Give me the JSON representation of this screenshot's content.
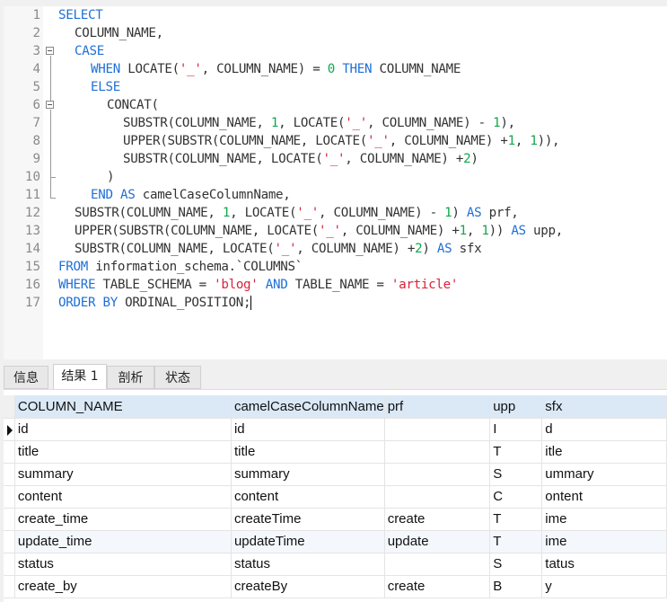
{
  "editor": {
    "lines": [
      {
        "n": "1",
        "indent": 0,
        "tokens": [
          [
            "kw",
            "SELECT"
          ]
        ]
      },
      {
        "n": "2",
        "indent": 1,
        "tokens": [
          [
            "",
            "COLUMN_NAME,"
          ]
        ]
      },
      {
        "n": "3",
        "indent": 1,
        "tokens": [
          [
            "kw",
            "CASE"
          ]
        ]
      },
      {
        "n": "4",
        "indent": 2,
        "tokens": [
          [
            "kw",
            "WHEN"
          ],
          [
            "",
            " LOCATE("
          ],
          [
            "str",
            "'_'"
          ],
          [
            "",
            ", COLUMN_NAME) = "
          ],
          [
            "num",
            "0"
          ],
          [
            "",
            " "
          ],
          [
            "kw",
            "THEN"
          ],
          [
            "",
            " COLUMN_NAME"
          ]
        ]
      },
      {
        "n": "5",
        "indent": 2,
        "tokens": [
          [
            "kw",
            "ELSE"
          ]
        ]
      },
      {
        "n": "6",
        "indent": 3,
        "tokens": [
          [
            "",
            "CONCAT("
          ]
        ]
      },
      {
        "n": "7",
        "indent": 4,
        "tokens": [
          [
            "",
            "SUBSTR(COLUMN_NAME, "
          ],
          [
            "num",
            "1"
          ],
          [
            "",
            ", LOCATE("
          ],
          [
            "str",
            "'_'"
          ],
          [
            "",
            ", COLUMN_NAME) - "
          ],
          [
            "num",
            "1"
          ],
          [
            "",
            "),"
          ]
        ]
      },
      {
        "n": "8",
        "indent": 4,
        "tokens": [
          [
            "",
            "UPPER(SUBSTR(COLUMN_NAME, LOCATE("
          ],
          [
            "str",
            "'_'"
          ],
          [
            "",
            ", COLUMN_NAME) +"
          ],
          [
            "num",
            "1"
          ],
          [
            "",
            ", "
          ],
          [
            "num",
            "1"
          ],
          [
            "",
            ")),"
          ]
        ]
      },
      {
        "n": "9",
        "indent": 4,
        "tokens": [
          [
            "",
            "SUBSTR(COLUMN_NAME, LOCATE("
          ],
          [
            "str",
            "'_'"
          ],
          [
            "",
            ", COLUMN_NAME) +"
          ],
          [
            "num",
            "2"
          ],
          [
            "",
            ")"
          ]
        ]
      },
      {
        "n": "10",
        "indent": 3,
        "tokens": [
          [
            "",
            ")"
          ]
        ]
      },
      {
        "n": "11",
        "indent": 2,
        "tokens": [
          [
            "kw",
            "END"
          ],
          [
            "",
            " "
          ],
          [
            "kw",
            "AS"
          ],
          [
            "",
            " camelCaseColumnName,"
          ]
        ]
      },
      {
        "n": "12",
        "indent": 1,
        "tokens": [
          [
            "",
            "SUBSTR(COLUMN_NAME, "
          ],
          [
            "num",
            "1"
          ],
          [
            "",
            ", LOCATE("
          ],
          [
            "str",
            "'_'"
          ],
          [
            "",
            ", COLUMN_NAME) - "
          ],
          [
            "num",
            "1"
          ],
          [
            "",
            ") "
          ],
          [
            "kw",
            "AS"
          ],
          [
            "",
            " prf,"
          ]
        ]
      },
      {
        "n": "13",
        "indent": 1,
        "tokens": [
          [
            "",
            "UPPER(SUBSTR(COLUMN_NAME, LOCATE("
          ],
          [
            "str",
            "'_'"
          ],
          [
            "",
            ", COLUMN_NAME) +"
          ],
          [
            "num",
            "1"
          ],
          [
            "",
            ", "
          ],
          [
            "num",
            "1"
          ],
          [
            "",
            "))"
          ],
          [
            "",
            " "
          ],
          [
            "kw",
            "AS"
          ],
          [
            "",
            " upp,"
          ]
        ]
      },
      {
        "n": "14",
        "indent": 1,
        "tokens": [
          [
            "",
            "SUBSTR(COLUMN_NAME, LOCATE("
          ],
          [
            "str",
            "'_'"
          ],
          [
            "",
            ", COLUMN_NAME) +"
          ],
          [
            "num",
            "2"
          ],
          [
            "",
            ") "
          ],
          [
            "kw",
            "AS"
          ],
          [
            "",
            " sfx"
          ]
        ]
      },
      {
        "n": "15",
        "indent": 0,
        "tokens": [
          [
            "kw",
            "FROM"
          ],
          [
            "",
            " information_schema.`COLUMNS`"
          ]
        ]
      },
      {
        "n": "16",
        "indent": 0,
        "tokens": [
          [
            "kw",
            "WHERE"
          ],
          [
            "",
            " TABLE_SCHEMA = "
          ],
          [
            "str",
            "'blog'"
          ],
          [
            "",
            " "
          ],
          [
            "kw",
            "AND"
          ],
          [
            "",
            " TABLE_NAME = "
          ],
          [
            "str",
            "'article'"
          ]
        ]
      },
      {
        "n": "17",
        "indent": 0,
        "tokens": [
          [
            "kw",
            "ORDER BY"
          ],
          [
            "",
            " ORDINAL_POSITION;"
          ]
        ]
      }
    ],
    "colors": {
      "keyword": "#1f6fd6",
      "string": "#d9213b",
      "number": "#0fa84a"
    }
  },
  "tabs": [
    {
      "label": "信息",
      "active": false
    },
    {
      "label": "结果 1",
      "active": true
    },
    {
      "label": "剖析",
      "active": false
    },
    {
      "label": "状态",
      "active": false
    }
  ],
  "results": {
    "columns": [
      "COLUMN_NAME",
      "camelCaseColumnName",
      "prf",
      "upp",
      "sfx"
    ],
    "rows": [
      [
        "id",
        "id",
        "",
        "I",
        "d"
      ],
      [
        "title",
        "title",
        "",
        "T",
        "itle"
      ],
      [
        "summary",
        "summary",
        "",
        "S",
        "ummary"
      ],
      [
        "content",
        "content",
        "",
        "C",
        "ontent"
      ],
      [
        "create_time",
        "createTime",
        "create",
        "T",
        "ime"
      ],
      [
        "update_time",
        "updateTime",
        "update",
        "T",
        "ime"
      ],
      [
        "status",
        "status",
        "",
        "S",
        "tatus"
      ],
      [
        "create_by",
        "createBy",
        "create",
        "B",
        "y"
      ]
    ],
    "current_row": 0
  }
}
